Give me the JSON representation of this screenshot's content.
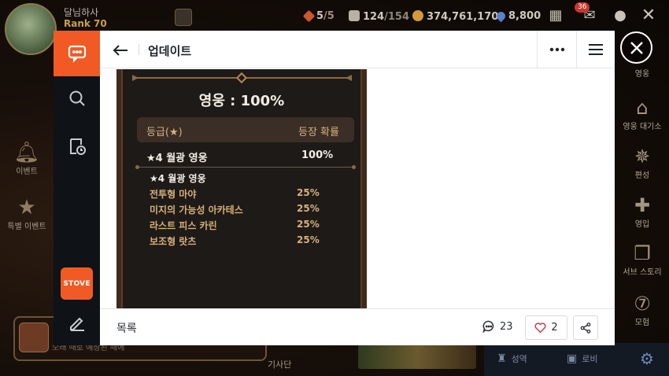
{
  "game": {
    "player_name": "달님하사",
    "player_rank": "Rank 70",
    "stamina_current": "5",
    "stamina_max": "/5",
    "skystone_current": "124",
    "skystone_max": "/154",
    "gold": "374,761,170",
    "crystal": "8,800",
    "mail_badge": "36",
    "left_side": {
      "event_label": "이벤트",
      "special_event_label": "특별 이벤트"
    },
    "right_side": [
      {
        "label": "영웅"
      },
      {
        "label": "영웅 대기소"
      },
      {
        "label": "편성"
      },
      {
        "label": "영입"
      },
      {
        "label": "서브 스토리"
      },
      {
        "label": "모험"
      }
    ],
    "bottom_left_text": "오래 때로 예상된 때에",
    "bottom_nav_text": "기사단",
    "bottom_right": {
      "sanctuary_label": "성역",
      "lobby_label": "로비"
    }
  },
  "stove": {
    "sidebar": {
      "stove_label": "STOVE"
    },
    "header": {
      "title": "업데이트"
    },
    "notice": {
      "title": "영웅 : 100%",
      "col_grade": "등급(★)",
      "col_rate": "등장 확률",
      "main_row": {
        "name": "★4 월광 영웅",
        "rate": "100%"
      },
      "sub_heading": "★4 월광 영웅",
      "heroes": [
        {
          "name": "전투형 마야",
          "rate": "25%"
        },
        {
          "name": "미지의 가능성 아카테스",
          "rate": "25%"
        },
        {
          "name": "라스트 피스 카린",
          "rate": "25%"
        },
        {
          "name": "보조형 랏츠",
          "rate": "25%"
        }
      ]
    },
    "footer": {
      "list_label": "목록",
      "comment_count": "23",
      "like_count": "2"
    }
  },
  "colors": {
    "stove_orange": "#f15a24",
    "notice_bg": "#1e1a17",
    "notice_gold": "#d6b07a",
    "like_heart": "#e0334a"
  }
}
